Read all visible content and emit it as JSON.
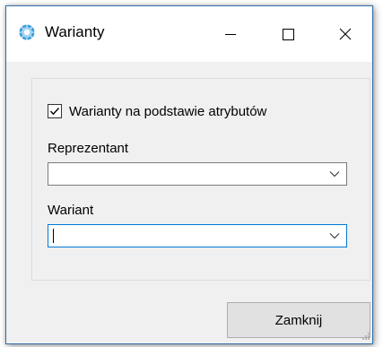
{
  "window": {
    "title": "Warianty",
    "icon": "app-circle-icon",
    "controls": {
      "minimize_icon": "minimize-icon",
      "maximize_icon": "maximize-icon",
      "close_icon": "close-icon"
    }
  },
  "form": {
    "checkbox": {
      "label": "Warianty na podstawie atrybutów",
      "checked": true
    },
    "reprezentant": {
      "label": "Reprezentant",
      "value": ""
    },
    "wariant": {
      "label": "Wariant",
      "value": "",
      "focused": true
    }
  },
  "footer": {
    "close_label": "Zamknij"
  },
  "colors": {
    "accent": "#0078d7",
    "window_border": "#2f6ea8",
    "icon_blue": "#3a9ad9"
  }
}
